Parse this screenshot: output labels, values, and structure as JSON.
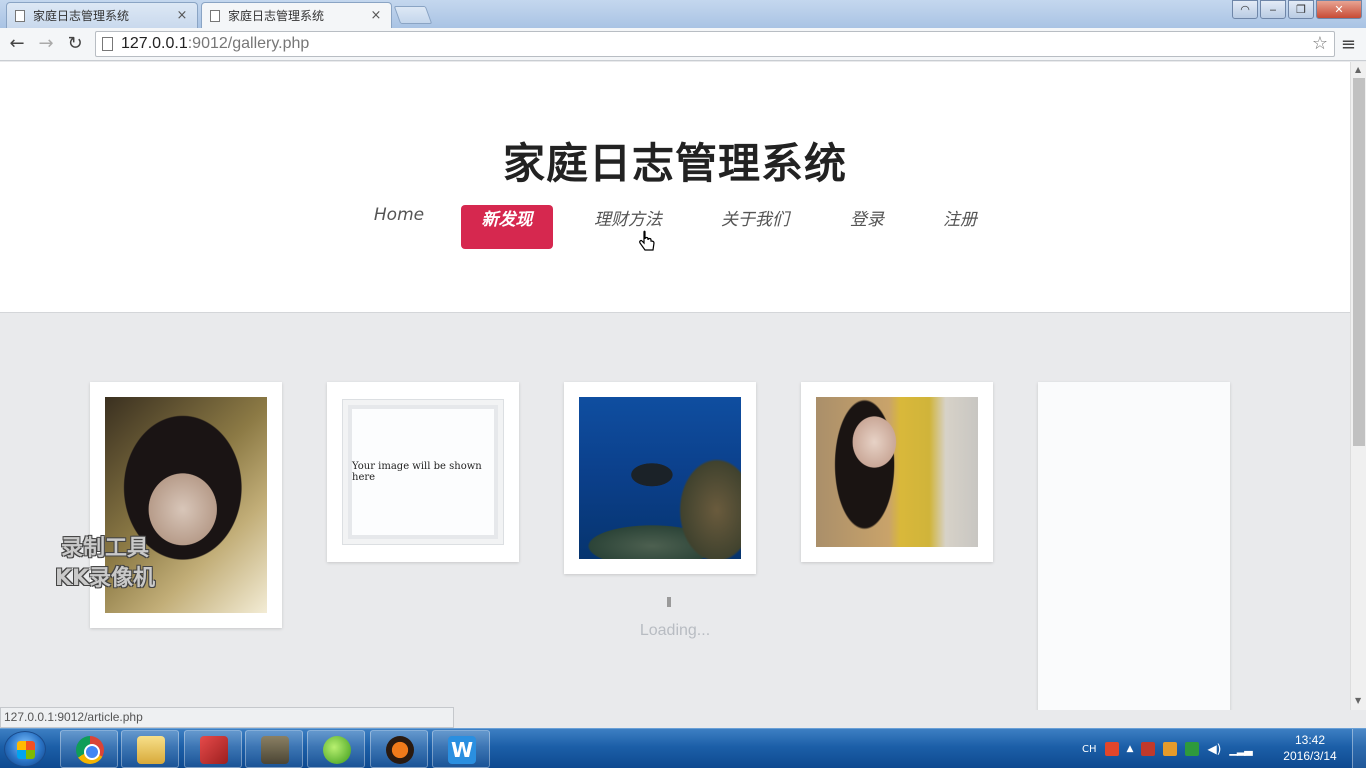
{
  "browser": {
    "tabs": [
      {
        "label": "家庭日志管理系统",
        "close": "×"
      },
      {
        "label": "家庭日志管理系统",
        "close": "×"
      }
    ],
    "window_buttons": {
      "user": "◠",
      "minimize": "‒",
      "restore": "❐",
      "close": "✕"
    },
    "nav": {
      "back": "←",
      "forward": "→",
      "reload": "↻",
      "star": "☆",
      "menu": "≡"
    },
    "url_host": "127.0.0.1",
    "url_rest": ":9012/gallery.php"
  },
  "site": {
    "title": "家庭日志管理系统",
    "nav": [
      {
        "label": "Home",
        "active": false
      },
      {
        "label": "新发现",
        "active": true
      },
      {
        "label": "理财方法",
        "active": false
      },
      {
        "label": "关于我们",
        "active": false
      },
      {
        "label": "登录",
        "active": false
      },
      {
        "label": "注册",
        "active": false
      }
    ],
    "accent_color": "#d6284f"
  },
  "gallery": {
    "placeholder_text": "Your image will be shown here",
    "loading_text": "Loading..."
  },
  "watermark": {
    "line1": "录制工具",
    "line2": "KK录像机"
  },
  "status_url": "127.0.0.1:9012/article.php",
  "taskbar": {
    "apps": [
      "chrome-icon",
      "folder-icon",
      "eraser-icon",
      "game-icon",
      "green-app-icon",
      "ninja-app-icon",
      "wps-icon"
    ],
    "wps_glyph": "W",
    "tray_lang": "CH",
    "clock_time": "13:42",
    "clock_date": "2016/3/14"
  }
}
